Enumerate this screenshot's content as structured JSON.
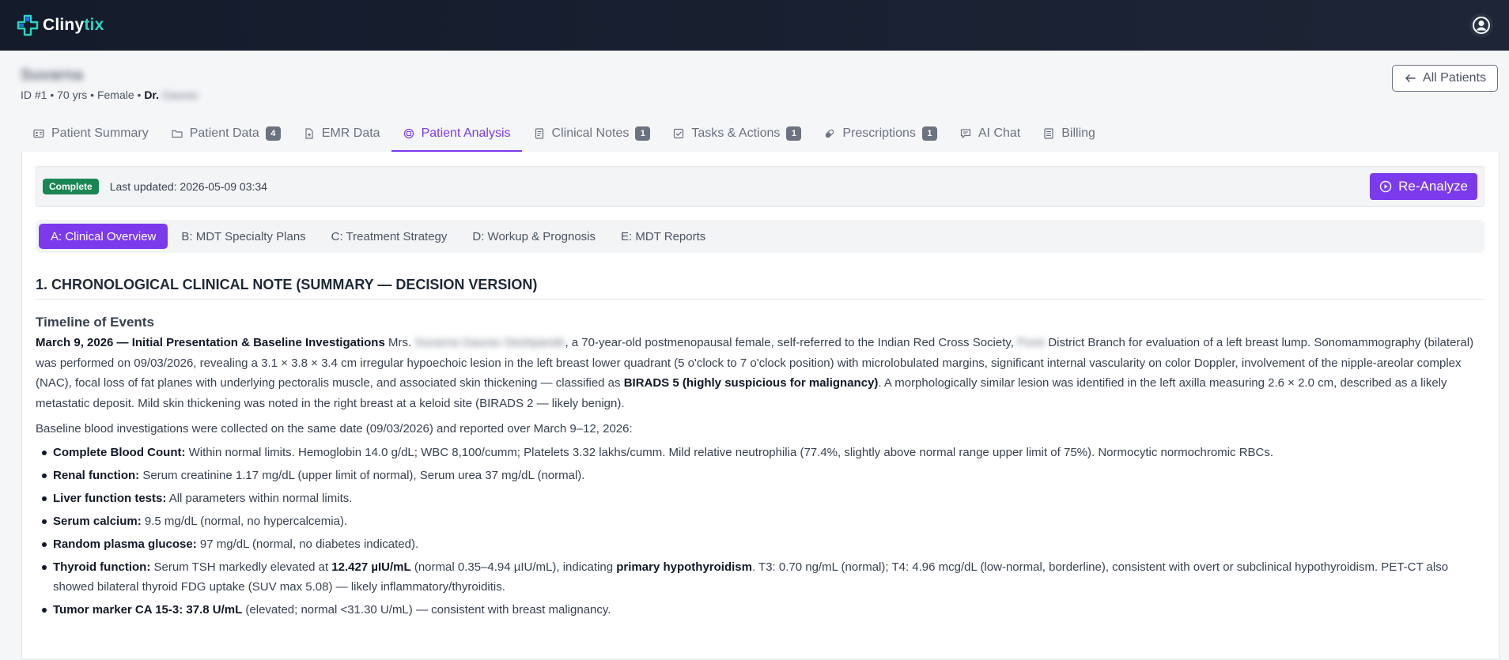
{
  "app": {
    "name_main": "Cliny",
    "name_accent": "tix"
  },
  "patient": {
    "name": "Suvarna",
    "meta_prefix": "ID #1 • 70 yrs • Female • ",
    "doctor_label": "Dr.",
    "doctor_name": "Gaurav"
  },
  "all_patients_label": "All Patients",
  "tabs": [
    {
      "label": "Patient Summary",
      "icon": "id-card-icon",
      "badge": ""
    },
    {
      "label": "Patient Data",
      "icon": "folder-icon",
      "badge": "4"
    },
    {
      "label": "EMR Data",
      "icon": "file-medical-icon",
      "badge": ""
    },
    {
      "label": "Patient Analysis",
      "icon": "cpu-icon",
      "badge": "",
      "active": true
    },
    {
      "label": "Clinical Notes",
      "icon": "note-icon",
      "badge": "1"
    },
    {
      "label": "Tasks & Actions",
      "icon": "checkbox-icon",
      "badge": "1"
    },
    {
      "label": "Prescriptions",
      "icon": "capsule-icon",
      "badge": "1"
    },
    {
      "label": "AI Chat",
      "icon": "chat-icon",
      "badge": ""
    },
    {
      "label": "Billing",
      "icon": "billing-icon",
      "badge": ""
    }
  ],
  "status": {
    "badge": "Complete",
    "updated": "Last updated: 2026-05-09 03:34",
    "reanalyze_label": "Re-Analyze"
  },
  "subtabs": [
    "A: Clinical Overview",
    "B: MDT Specialty Plans",
    "C: Treatment Strategy",
    "D: Workup & Prognosis",
    "E: MDT Reports"
  ],
  "section": {
    "heading": "1. CHRONOLOGICAL CLINICAL NOTE (SUMMARY — DECISION VERSION)",
    "subheading": "Timeline of Events",
    "p1": {
      "lead": "March 9, 2026 — Initial Presentation & Baseline Investigations",
      "t1": " Mrs. ",
      "redacted_name": "Suvarna Gaurav Deshpande",
      "t2": ", a 70-year-old postmenopausal female, self-referred to the Indian Red Cross Society, ",
      "redacted_place": "Pune",
      "t3": " District Branch for evaluation of a left breast lump. Sonomammography (bilateral) was performed on 09/03/2026, revealing a 3.1 × 3.8 × 3.4 cm irregular hypoechoic lesion in the left breast lower quadrant (5 o'clock to 7 o'clock position) with microlobulated margins, significant internal vascularity on color Doppler, involvement of the nipple-areolar complex (NAC), focal loss of fat planes with underlying pectoralis muscle, and associated skin thickening — classified as ",
      "birads": "BIRADS 5 (highly suspicious for malignancy)",
      "t4": ". A morphologically similar lesion was identified in the left axilla measuring 2.6 × 2.0 cm, described as a likely metastatic deposit. Mild skin thickening was noted in the right breast at a keloid site (BIRADS 2 — likely benign)."
    },
    "p2": "Baseline blood investigations were collected on the same date (09/03/2026) and reported over March 9–12, 2026:",
    "items": [
      {
        "label": "Complete Blood Count:",
        "text": " Within normal limits. Hemoglobin 14.0 g/dL; WBC 8,100/cumm; Platelets 3.32 lakhs/cumm. Mild relative neutrophilia (77.4%, slightly above normal range upper limit of 75%). Normocytic normochromic RBCs."
      },
      {
        "label": "Renal function:",
        "text": " Serum creatinine 1.17 mg/dL (upper limit of normal), Serum urea 37 mg/dL (normal)."
      },
      {
        "label": "Liver function tests:",
        "text": " All parameters within normal limits."
      },
      {
        "label": "Serum calcium:",
        "text": " 9.5 mg/dL (normal, no hypercalcemia)."
      },
      {
        "label": "Random plasma glucose:",
        "text": " 97 mg/dL (normal, no diabetes indicated)."
      }
    ],
    "thyroid": {
      "label": "Thyroid function:",
      "t1": " Serum TSH markedly elevated at ",
      "tsh": "12.427 µIU/mL",
      "t2": " (normal 0.35–4.94 µIU/mL), indicating ",
      "dx": "primary hypothyroidism",
      "t3": ". T3: 0.70 ng/mL (normal); T4: 4.96 mcg/dL (low-normal, borderline), consistent with overt or subclinical hypothyroidism. PET-CT also showed bilateral thyroid FDG uptake (SUV max 5.08) — likely inflammatory/thyroiditis."
    },
    "tumor": {
      "label": "Tumor marker CA 15-3: 37.8 U/mL",
      "text": " (elevated; normal <31.30 U/mL) — consistent with breast malignancy."
    }
  }
}
